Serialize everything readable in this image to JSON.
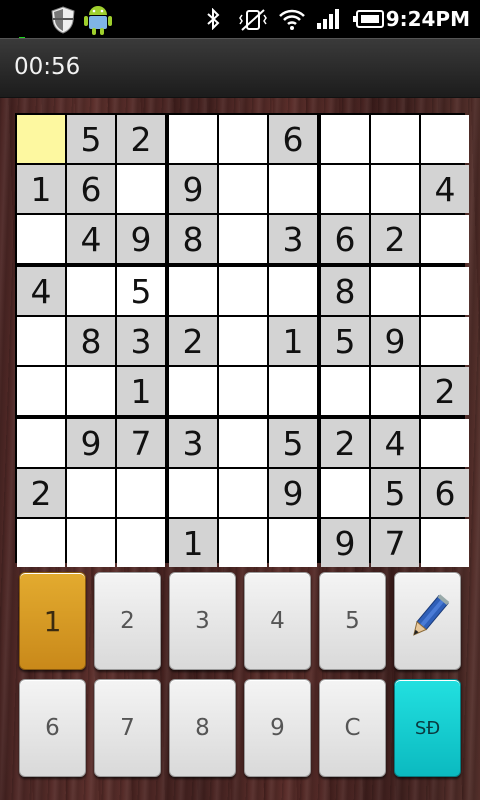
{
  "status_bar": {
    "time": "9:24PM",
    "icons": [
      "notification-dot-icon",
      "shield-icon",
      "android-icon",
      "bluetooth-icon",
      "vibrate-mute-icon",
      "wifi-icon",
      "signal-icon",
      "battery-icon"
    ]
  },
  "header": {
    "timer": "00:56"
  },
  "board": {
    "rows": [
      [
        "",
        "5",
        "2",
        "",
        "",
        "6",
        "",
        "",
        ""
      ],
      [
        "1",
        "6",
        "",
        "9",
        "",
        "",
        "",
        "",
        "4"
      ],
      [
        "",
        "4",
        "9",
        "8",
        "",
        "3",
        "6",
        "2",
        ""
      ],
      [
        "4",
        "",
        "5",
        "",
        "",
        "",
        "8",
        "",
        ""
      ],
      [
        "",
        "8",
        "3",
        "2",
        "",
        "1",
        "5",
        "9",
        ""
      ],
      [
        "",
        "",
        "1",
        "",
        "",
        "",
        "",
        "",
        "2"
      ],
      [
        "",
        "9",
        "7",
        "3",
        "",
        "5",
        "2",
        "4",
        ""
      ],
      [
        "2",
        "",
        "",
        "",
        "",
        "9",
        "",
        "5",
        "6"
      ],
      [
        "",
        "",
        "",
        "1",
        "",
        "",
        "9",
        "7",
        ""
      ]
    ],
    "shaded": [
      [
        0,
        1,
        1,
        0,
        0,
        1,
        0,
        0,
        0
      ],
      [
        1,
        1,
        0,
        1,
        0,
        0,
        0,
        0,
        1
      ],
      [
        0,
        1,
        1,
        1,
        0,
        1,
        1,
        1,
        0
      ],
      [
        1,
        0,
        0,
        0,
        0,
        0,
        1,
        0,
        0
      ],
      [
        0,
        1,
        1,
        1,
        0,
        1,
        1,
        1,
        0
      ],
      [
        0,
        0,
        1,
        0,
        0,
        0,
        0,
        0,
        1
      ],
      [
        0,
        1,
        1,
        1,
        0,
        1,
        1,
        1,
        0
      ],
      [
        1,
        0,
        0,
        0,
        0,
        1,
        0,
        1,
        1
      ],
      [
        0,
        0,
        0,
        1,
        0,
        0,
        1,
        1,
        0
      ]
    ],
    "selected": [
      0,
      0
    ]
  },
  "keypad": {
    "row1": [
      "1",
      "2",
      "3",
      "4",
      "5"
    ],
    "row2": [
      "6",
      "7",
      "8",
      "9",
      "C",
      "SĐ"
    ],
    "active_key": "1",
    "pencil_icon": "pencil-icon"
  },
  "colors": {
    "selected_cell": "#fdf8a0",
    "given_cell": "#d3d3d3",
    "active_key": "#d89a25",
    "special_key": "#14d0d4"
  }
}
